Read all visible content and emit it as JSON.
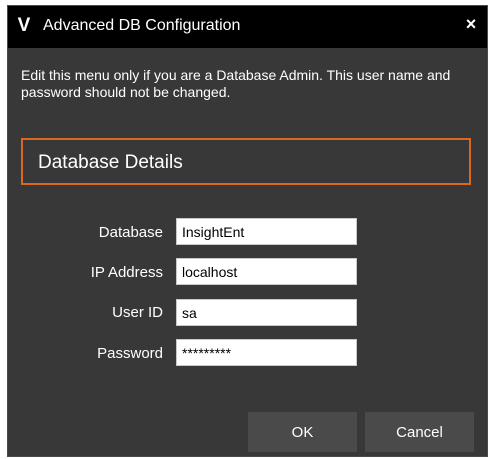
{
  "window": {
    "logo_glyph": "V",
    "title": "Advanced DB Configuration",
    "close_glyph": "×"
  },
  "description": "Edit this menu only if you are a Database Admin.  This user name and password should not be changed.",
  "section": {
    "title": "Database Details"
  },
  "fields": {
    "database": {
      "label": "Database",
      "value": "InsightEnt"
    },
    "ip_address": {
      "label": "IP Address",
      "value": "localhost"
    },
    "user_id": {
      "label": "User ID",
      "value": "sa"
    },
    "password": {
      "label": "Password",
      "value": "*********"
    }
  },
  "buttons": {
    "ok": "OK",
    "cancel": "Cancel"
  },
  "colors": {
    "dialog_background": "#383838",
    "titlebar_background": "#000000",
    "section_border": "#d9691f",
    "button_background": "#4a4a4a"
  }
}
